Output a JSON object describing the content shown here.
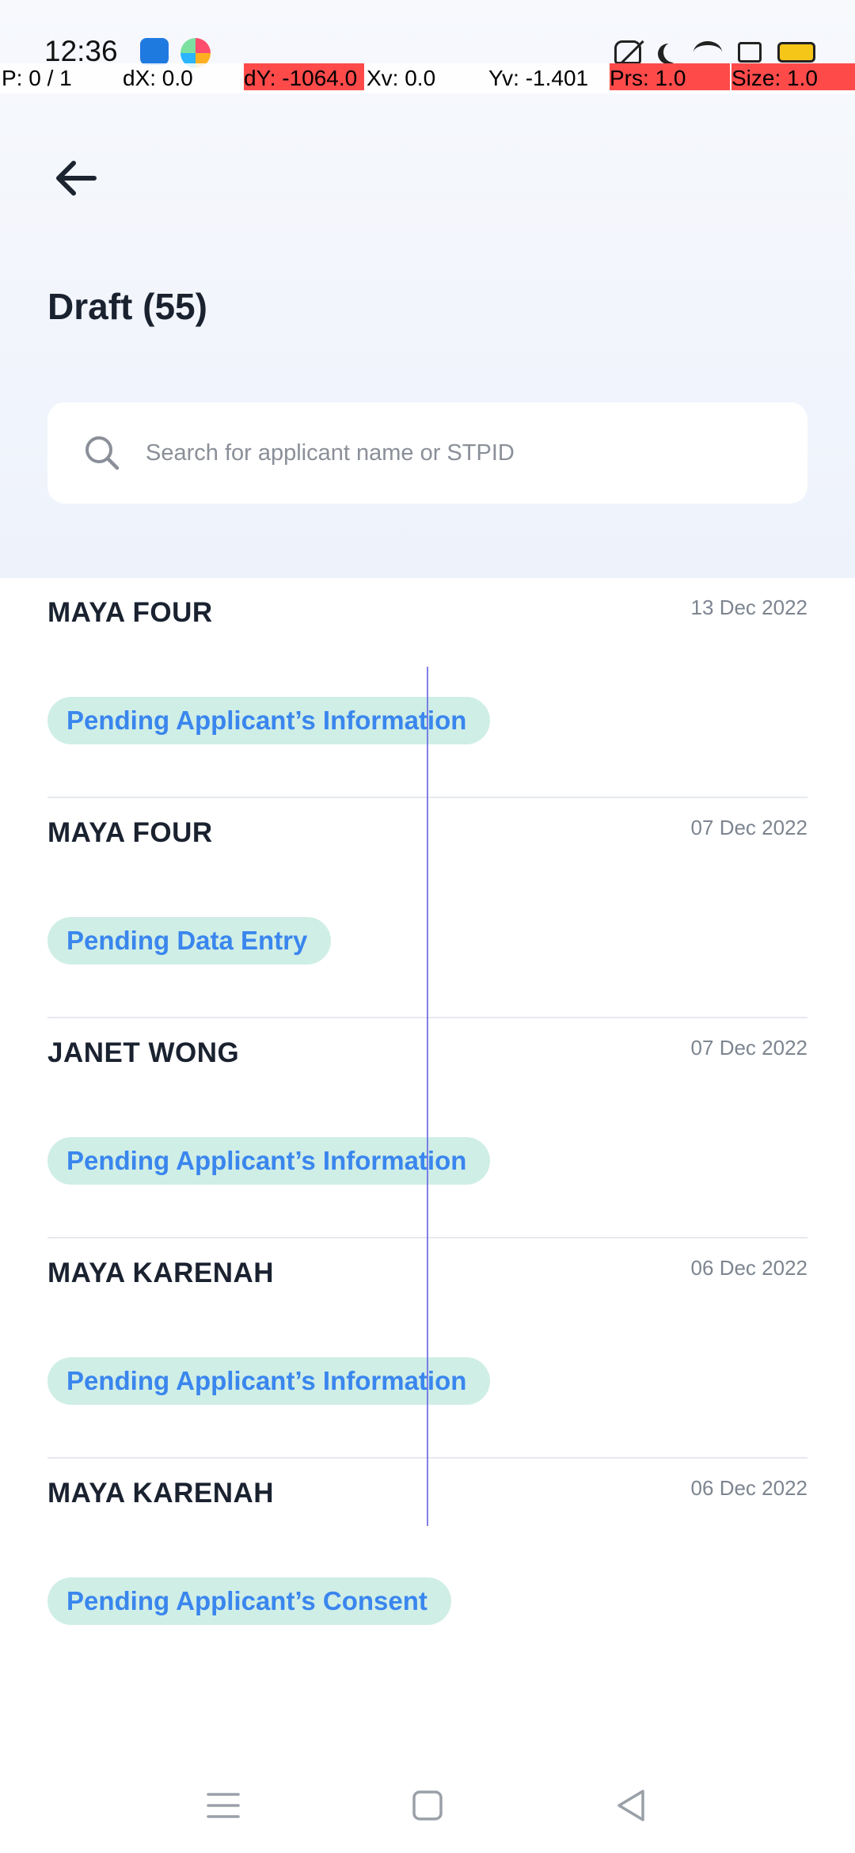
{
  "status_bar": {
    "time": "12:36"
  },
  "debug_overlay": {
    "pointer": "P: 0 / 1",
    "dx": "dX: 0.0",
    "dy": "dY: -1064.0",
    "xv": "Xv: 0.0",
    "yv": "Yv: -1.401",
    "prs": "Prs: 1.0",
    "size": "Size: 1.0"
  },
  "header": {
    "title": "Draft (55)"
  },
  "search": {
    "placeholder": "Search for applicant name or STPID"
  },
  "drafts": [
    {
      "name": "MAYA FOUR",
      "date": "13 Dec 2022",
      "status": "Pending Applicant’s Information"
    },
    {
      "name": "MAYA FOUR",
      "date": "07 Dec 2022",
      "status": "Pending Data Entry"
    },
    {
      "name": "JANET WONG",
      "date": "07 Dec 2022",
      "status": "Pending Applicant’s Information"
    },
    {
      "name": "MAYA KARENAH",
      "date": "06 Dec 2022",
      "status": "Pending Applicant’s Information"
    },
    {
      "name": "MAYA KARENAH",
      "date": "06 Dec 2022",
      "status": "Pending Applicant’s Consent"
    }
  ],
  "colors": {
    "badge_bg": "#cfeee6",
    "badge_text": "#3a86ee",
    "header_bg": "#eef2fb"
  }
}
